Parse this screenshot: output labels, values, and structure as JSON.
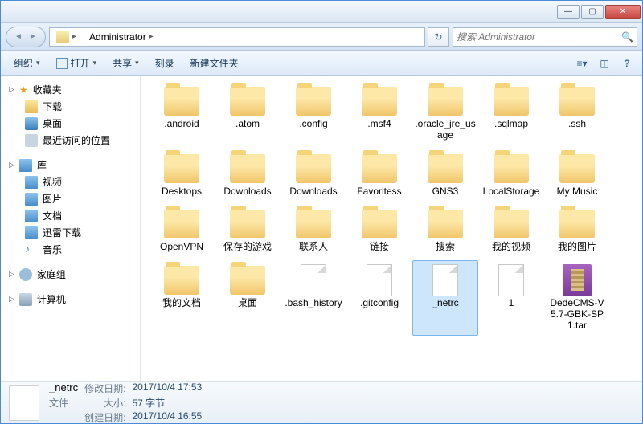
{
  "titlebar": {
    "min": "—",
    "max": "▢",
    "close": "✕"
  },
  "address": {
    "crumb": "Administrator",
    "arrow": "▸"
  },
  "search": {
    "placeholder": "搜索 Administrator",
    "icon": "🔍"
  },
  "refresh": {
    "icon": "↻"
  },
  "toolbar": {
    "organize": "组织",
    "open": "打开",
    "share": "共享",
    "burn": "刻录",
    "newfolder": "新建文件夹",
    "dd": "▾",
    "help": "?"
  },
  "sidebar": {
    "fav": {
      "label": "收藏夹",
      "items": [
        "下载",
        "桌面",
        "最近访问的位置"
      ]
    },
    "lib": {
      "label": "库",
      "items": [
        "视频",
        "图片",
        "文档",
        "迅雷下载",
        "音乐"
      ]
    },
    "home": {
      "label": "家庭组"
    },
    "pc": {
      "label": "计算机"
    }
  },
  "files": [
    {
      "name": ".android",
      "type": "folder"
    },
    {
      "name": ".atom",
      "type": "folder"
    },
    {
      "name": ".config",
      "type": "folder"
    },
    {
      "name": ".msf4",
      "type": "folder"
    },
    {
      "name": ".oracle_jre_usage",
      "type": "folder"
    },
    {
      "name": ".sqlmap",
      "type": "folder"
    },
    {
      "name": ".ssh",
      "type": "folder"
    },
    {
      "name": "Desktops",
      "type": "folder"
    },
    {
      "name": "Downloads",
      "type": "folder"
    },
    {
      "name": "Downloads",
      "type": "folder"
    },
    {
      "name": "Favoritess",
      "type": "folder"
    },
    {
      "name": "GNS3",
      "type": "folder"
    },
    {
      "name": "LocalStorage",
      "type": "folder"
    },
    {
      "name": "My Music",
      "type": "folder"
    },
    {
      "name": "OpenVPN",
      "type": "folder"
    },
    {
      "name": "保存的游戏",
      "type": "folder",
      "ovl": "spade"
    },
    {
      "name": "联系人",
      "type": "folder",
      "ovl": "contact"
    },
    {
      "name": "链接",
      "type": "folder",
      "ovl": "link"
    },
    {
      "name": "搜索",
      "type": "folder",
      "ovl": "search"
    },
    {
      "name": "我的视频",
      "type": "folder"
    },
    {
      "name": "我的图片",
      "type": "folder"
    },
    {
      "name": "我的文档",
      "type": "folder"
    },
    {
      "name": "桌面",
      "type": "folder"
    },
    {
      "name": ".bash_history",
      "type": "file"
    },
    {
      "name": ".gitconfig",
      "type": "file"
    },
    {
      "name": "_netrc",
      "type": "file",
      "selected": true
    },
    {
      "name": "1",
      "type": "file"
    },
    {
      "name": "DedeCMS-V5.7-GBK-SP1.tar",
      "type": "rar"
    }
  ],
  "status": {
    "name": "_netrc",
    "type": "文件",
    "modified_label": "修改日期:",
    "modified": "2017/10/4 17:53",
    "size_label": "大小:",
    "size": "57 字节",
    "created_label": "创建日期:",
    "created": "2017/10/4 16:55"
  }
}
